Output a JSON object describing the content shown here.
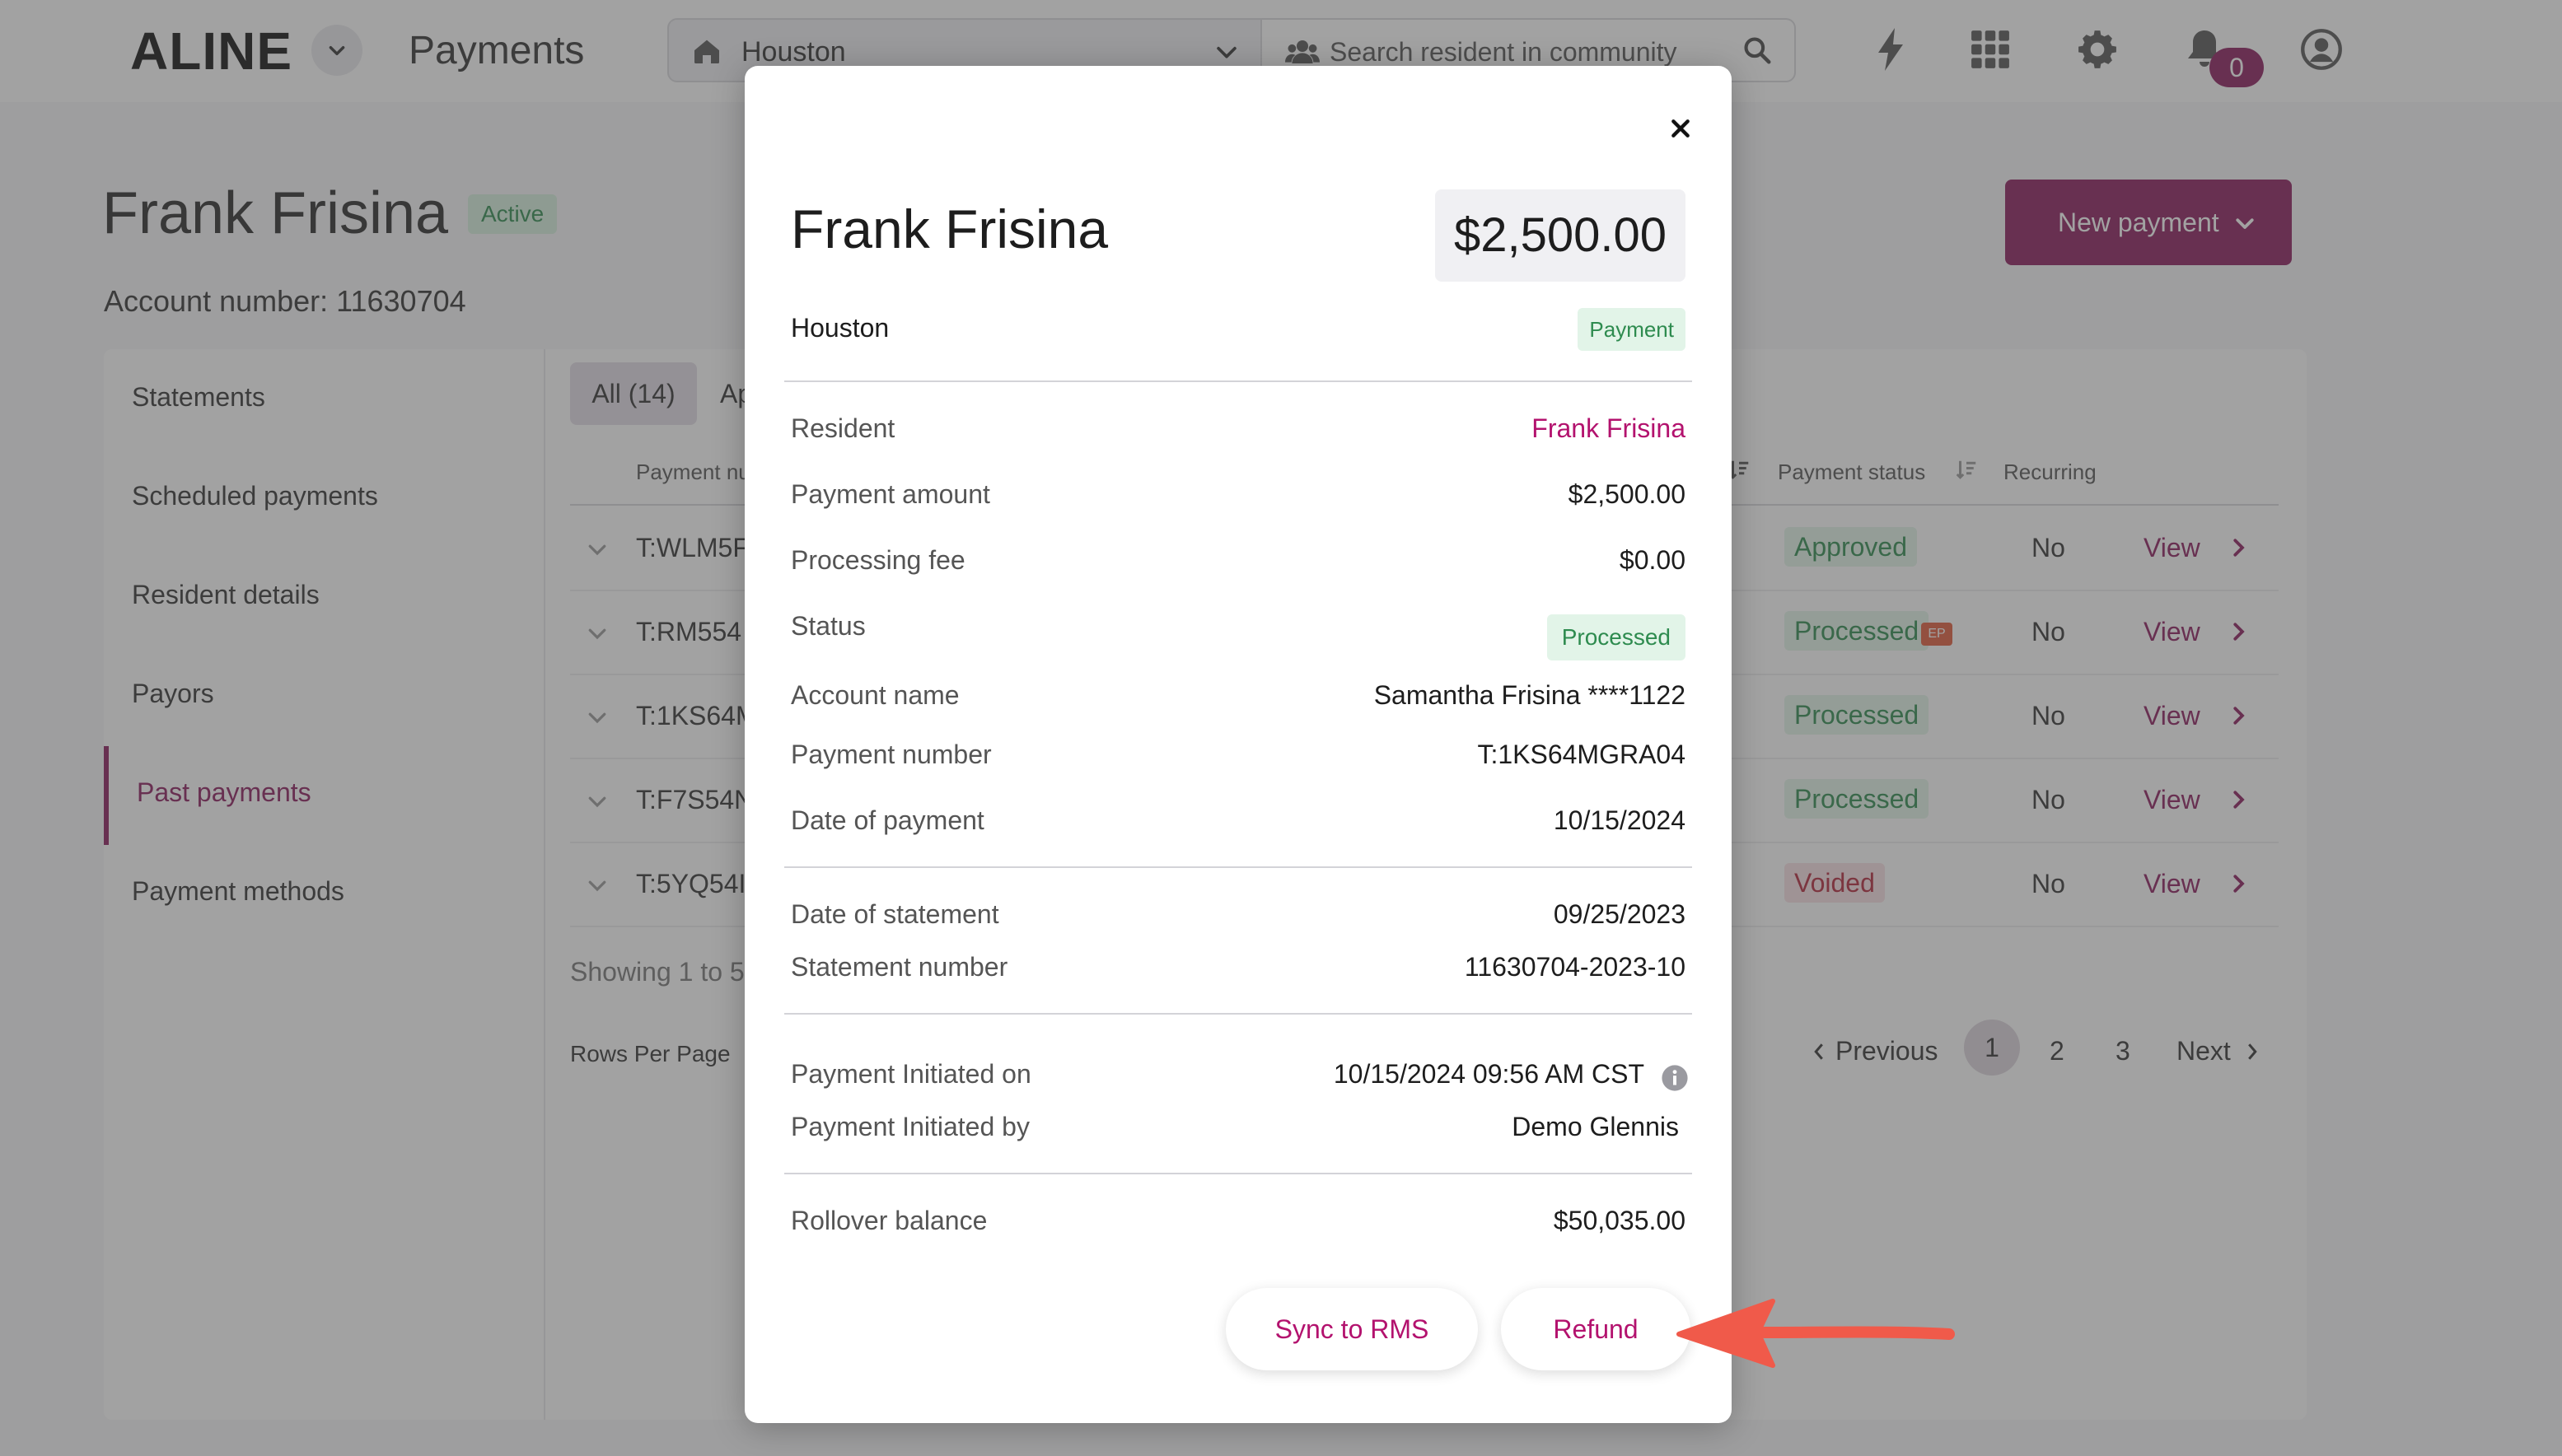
{
  "topbar": {
    "logo": "ALINE",
    "app_title": "Payments",
    "community": "Houston",
    "search_placeholder": "Search resident in community",
    "notification_count": "0"
  },
  "page": {
    "resident_name": "Frank Frisina",
    "resident_status": "Active",
    "account_number_label": "Account number: 11630704",
    "new_payment_label": "New payment"
  },
  "sidebar": {
    "items": [
      {
        "label": "Statements",
        "active": false
      },
      {
        "label": "Scheduled payments",
        "active": false
      },
      {
        "label": "Resident details",
        "active": false
      },
      {
        "label": "Payors",
        "active": false
      },
      {
        "label": "Past payments",
        "active": true
      },
      {
        "label": "Payment methods",
        "active": false
      }
    ]
  },
  "tabs": {
    "all": "All (14)",
    "next_partial": "Ap"
  },
  "table": {
    "headers": {
      "payment_number": "Payment nu",
      "payment_status": "Payment status",
      "recurring": "Recurring"
    },
    "rows": [
      {
        "payment_number": "T:WLM5F",
        "status": "Approved",
        "ep": "",
        "recurring": "No",
        "action": "View"
      },
      {
        "payment_number": "T:RM554",
        "status": "Processed",
        "ep": "EP",
        "recurring": "No",
        "action": "View"
      },
      {
        "payment_number": "T:1KS64M",
        "status": "Processed",
        "ep": "",
        "recurring": "No",
        "action": "View"
      },
      {
        "payment_number": "T:F7S54N",
        "status": "Processed",
        "ep": "",
        "recurring": "No",
        "action": "View"
      },
      {
        "payment_number": "T:5YQ54I",
        "status": "Voided",
        "ep": "",
        "recurring": "No",
        "action": "View"
      }
    ],
    "showing": "Showing 1 to 5",
    "rows_per_page_label": "Rows Per Page"
  },
  "pagination": {
    "previous": "Previous",
    "pages": [
      "1",
      "2",
      "3"
    ],
    "current": "1",
    "next": "Next"
  },
  "modal": {
    "resident_name": "Frank Frisina",
    "amount": "$2,500.00",
    "community": "Houston",
    "type_badge": "Payment",
    "resident_label": "Resident",
    "resident_value": "Frank Frisina",
    "payment_amount_label": "Payment amount",
    "payment_amount_value": "$2,500.00",
    "processing_fee_label": "Processing fee",
    "processing_fee_value": "$0.00",
    "status_label": "Status",
    "status_value": "Processed",
    "account_name_label": "Account name",
    "account_name_value": "Samantha Frisina ****1122",
    "payment_number_label": "Payment number",
    "payment_number_value": "T:1KS64MGRA04",
    "date_of_payment_label": "Date of payment",
    "date_of_payment_value": "10/15/2024",
    "date_of_statement_label": "Date of statement",
    "date_of_statement_value": "09/25/2023",
    "statement_number_label": "Statement number",
    "statement_number_value": "11630704-2023-10",
    "initiated_on_label": "Payment Initiated on",
    "initiated_on_value": "10/15/2024 09:56 AM CST",
    "initiated_by_label": "Payment Initiated by",
    "initiated_by_value": "Demo Glennis",
    "rollover_label": "Rollover balance",
    "rollover_value": "$50,035.00",
    "sync_button": "Sync to RMS",
    "refund_button": "Refund"
  },
  "colors": {
    "brand": "#8b1a5c",
    "link": "#b3126e",
    "success_bg": "#e2f4e8",
    "success_text": "#2e8b4f",
    "danger_bg": "#f8e1e4",
    "danger_text": "#b3263a",
    "callout_arrow": "#f05a4a"
  }
}
